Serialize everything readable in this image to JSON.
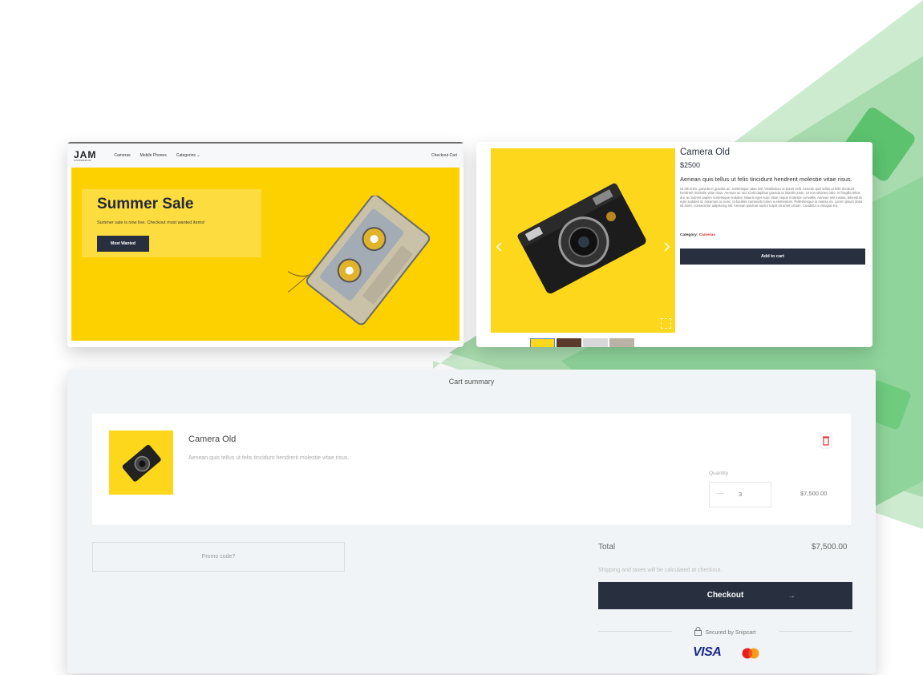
{
  "store": {
    "logo_main": "JAM",
    "logo_sub": "COMMERCE",
    "nav": [
      "Cameras",
      "Mobile Phones",
      "Categories ⌄"
    ],
    "cart_link": "Checkout Cart",
    "hero_title": "Summer Sale",
    "hero_subtitle": "Summer sale is now live. Checkout most wanted items!",
    "hero_button": "Most Wanted"
  },
  "product": {
    "title": "Camera Old",
    "price": "$2500",
    "lead": "Aenean quis tellus ut felis tincidunt hendrerit molestie vitae risus.",
    "description": "Ut elit enim, gravida et gravida ac, scelerisque vitae nisl. Vestibulum ut purus velit. Aenean quis tellus ut felis tincidunt hendrerit molestie vitae risus. Aenean ac orci id elit dapibus gravida ut lobortis justo. Ut non ultricies odio. In fringilla tellus dui, ac laoreet sapien scelerisque sodales. Mauris eget nunc vitae neque molestie convallis. Aenean nisl massa, bibendum eget sodales id, maximus ac nunc. In facilisis commodo lorem a elementum. Pellentesque ut massa mi. Lorem ipsum dolor sit amet, consectetur adipiscing elit. Aenean pulvinar auctor turpis sit amet ornare. Curabitur a volutpat leo.",
    "category_label": "Category:",
    "category_value": "Cameras",
    "add_to_cart": "Add to cart"
  },
  "cart": {
    "title": "Cart summary",
    "item_name": "Camera Old",
    "item_desc": "Aenean quis tellus ut felis tincidunt hendrerit molestie vitae risus.",
    "quantity_label": "Quantity",
    "quantity_minus": "—",
    "quantity_value": "3",
    "item_price": "$7,500.00",
    "promo": "Promo code?",
    "total_label": "Total",
    "total_value": "$7,500.00",
    "shipping_note": "Shipping and taxes will be calculated at checkout.",
    "checkout": "Checkout",
    "checkout_icon": "→",
    "secured": "Secured by Snipcart",
    "visa": "VISA"
  },
  "colors": {
    "brand_dark": "#283040",
    "accent_yellow": "#fdd000",
    "accent_red": "#e2323a",
    "bg_green": "#6cc47a"
  }
}
